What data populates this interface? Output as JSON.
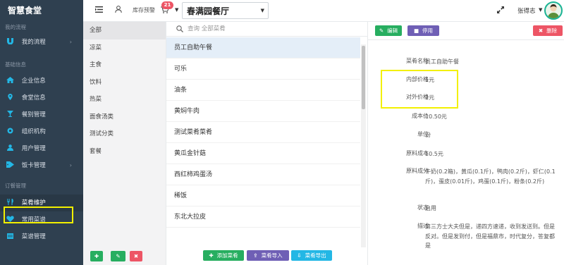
{
  "sidebar": {
    "brand": "智慧食堂",
    "sections": [
      {
        "title": "我的流程",
        "items": [
          {
            "label": "我的流程",
            "icon": "magnet-icon",
            "chevron": true
          }
        ]
      },
      {
        "title": "基础信息",
        "items": [
          {
            "label": "企业信息",
            "icon": "home-icon",
            "chevron": false
          },
          {
            "label": "食堂信息",
            "icon": "map-marker-icon",
            "chevron": false
          },
          {
            "label": "餐别管理",
            "icon": "cocktail-glass-icon",
            "chevron": false
          },
          {
            "label": "组织机构",
            "icon": "sitemap-icon",
            "chevron": false
          },
          {
            "label": "用户管理",
            "icon": "user-icon",
            "chevron": false
          },
          {
            "label": "饭卡管理",
            "icon": "tag-icon",
            "chevron": true
          }
        ]
      },
      {
        "title": "订餐管理",
        "items": [
          {
            "label": "菜肴维护",
            "icon": "cutlery-icon",
            "chevron": false
          },
          {
            "label": "常用菜谱",
            "icon": "heart-icon",
            "chevron": false
          },
          {
            "label": "菜谱管理",
            "icon": "calendar-icon",
            "chevron": false
          }
        ]
      }
    ]
  },
  "topbar": {
    "stock_label": "库存预警",
    "stock_count": "21",
    "store": "春满园餐厅",
    "user_name": "张得志"
  },
  "categories": [
    "全部",
    "凉菜",
    "主食",
    "饮料",
    "热菜",
    "面食汤类",
    "测试分类",
    "套餐"
  ],
  "search": {
    "placeholder": "查询 全部菜肴"
  },
  "dishes": [
    "员工自助午餐",
    "可乐",
    "油条",
    "黄焖牛肉",
    "测试菜肴菜肴",
    "黄瓜金针菇",
    "西红柿鸡蛋汤",
    "稀饭",
    "东北大拉皮"
  ],
  "dish_actions": {
    "add": "添加菜肴",
    "import": "菜肴导入",
    "export": "菜肴导出"
  },
  "detail": {
    "edit": "编辑",
    "disable": "停用",
    "delete": "删除",
    "fields": [
      {
        "label": "菜肴名称",
        "value": "员工自助午餐"
      },
      {
        "label": "内部价格",
        "value": "1元"
      },
      {
        "label": "对外价格",
        "value": "2元"
      },
      {
        "label": "成本价",
        "value": "10.50元"
      },
      {
        "label": "单位",
        "value": "份"
      },
      {
        "label": "原料成本",
        "value": "10.5元"
      },
      {
        "label": "原料成分",
        "value": "牛奶(0.2箱)，黄瓜(0.1斤)，鸭肉(0.2斤)，虾仁(0.1斤)，蛋皮(0.01斤)，鸡蛋(0.1斤)，粉条(0.2斤)"
      },
      {
        "label": "状态",
        "value": "启用"
      },
      {
        "label": "描述",
        "value": "第三方士大夫但是，递四方速递，收到发送到。但是反对。但是发到付，但是福鼎市，时代复分，答复都是"
      }
    ]
  },
  "colors": {
    "sidebar_bg": "#2f4050",
    "accent_green": "#1ab394",
    "danger_red": "#ed5565",
    "purple": "#6f5fb5",
    "info_blue": "#23b7e5",
    "highlight_yellow": "#f3f000"
  }
}
